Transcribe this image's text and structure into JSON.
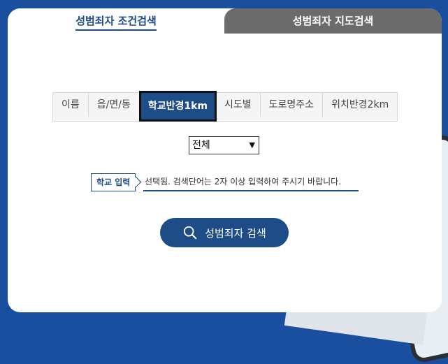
{
  "tabs": [
    {
      "label": "성범죄자 조건검색",
      "active": true
    },
    {
      "label": "성범죄자 지도검색",
      "active": false
    }
  ],
  "filters": [
    {
      "label": "이름",
      "active": false
    },
    {
      "label": "읍/면/동",
      "active": false
    },
    {
      "label": "학교반경1km",
      "active": true
    },
    {
      "label": "시도별",
      "active": false
    },
    {
      "label": "도로명주소",
      "active": false
    },
    {
      "label": "위치반경2km",
      "active": false
    }
  ],
  "region_select": {
    "value": "전체"
  },
  "school_input": {
    "label": "학교 입력",
    "placeholder": "선택됨. 검색단어는 2자 이상 입력하여 주시기 바랍니다."
  },
  "search_button": {
    "label": "성범죄자 검색",
    "icon": "search-icon"
  },
  "colors": {
    "primary": "#1d4c86",
    "inactive_tab": "#6b6b6b",
    "background": "#1a4fa0"
  }
}
